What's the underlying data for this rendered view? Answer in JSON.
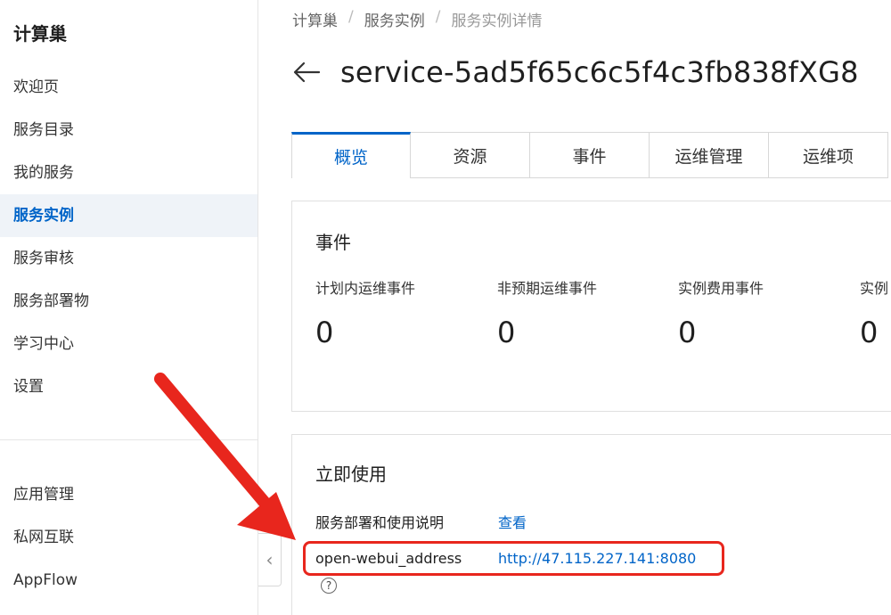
{
  "sidebar": {
    "title": "计算巢",
    "items": [
      {
        "label": "欢迎页"
      },
      {
        "label": "服务目录"
      },
      {
        "label": "我的服务"
      },
      {
        "label": "服务实例"
      },
      {
        "label": "服务审核"
      },
      {
        "label": "服务部署物"
      },
      {
        "label": "学习中心"
      },
      {
        "label": "设置"
      }
    ],
    "bottom_items": [
      {
        "label": "应用管理"
      },
      {
        "label": "私网互联"
      },
      {
        "label": "AppFlow"
      }
    ],
    "active_index": 3
  },
  "breadcrumb": [
    "计算巢",
    "服务实例",
    "服务实例详情"
  ],
  "page": {
    "title": "service-5ad5f65c6c5f4c3fb838fXG8"
  },
  "tabs": [
    "概览",
    "资源",
    "事件",
    "运维管理",
    "运维项"
  ],
  "events_card": {
    "title": "事件",
    "stats": [
      {
        "label": "计划内运维事件",
        "value": "0"
      },
      {
        "label": "非预期运维事件",
        "value": "0"
      },
      {
        "label": "实例费用事件",
        "value": "0"
      },
      {
        "label": "实例",
        "value": "0"
      }
    ]
  },
  "usage_card": {
    "title": "立即使用",
    "guide_label": "服务部署和使用说明",
    "guide_link": "查看",
    "address_label": "open-webui_address",
    "address_value": "http://47.115.227.141:8080",
    "help_glyph": "?"
  },
  "collapse_glyph": "‹",
  "colors": {
    "accent": "#0064c8",
    "highlight": "#e8261d",
    "active_bg": "#eff3f8"
  },
  "icons": [
    "back-arrow-icon",
    "help-icon",
    "collapse-left-icon",
    "annotation-arrow-icon"
  ]
}
